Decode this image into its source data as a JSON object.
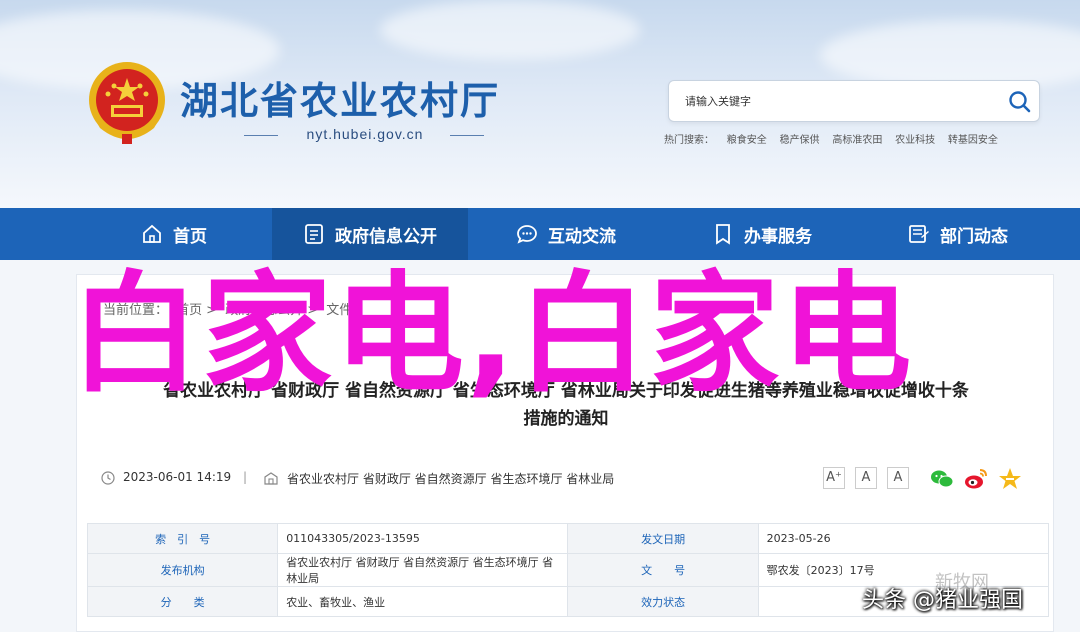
{
  "header": {
    "site_title": "湖北省农业农村厅",
    "domain": "nyt.hubei.gov.cn",
    "search_placeholder": "请输入关键字",
    "hot_search_label": "热门搜索：",
    "hot_search_items": [
      "粮食安全",
      "稳产保供",
      "高标准农田",
      "农业科技",
      "转基因安全"
    ]
  },
  "nav": {
    "items": [
      {
        "label": "首页",
        "icon": "home-icon"
      },
      {
        "label": "政府信息公开",
        "icon": "document-list-icon"
      },
      {
        "label": "互动交流",
        "icon": "chat-bubble-icon"
      },
      {
        "label": "办事服务",
        "icon": "bookmark-icon"
      },
      {
        "label": "部门动态",
        "icon": "news-icon"
      }
    ],
    "active_index": 1
  },
  "article": {
    "breadcrumb_label": "当前位置：",
    "breadcrumb": [
      "首页",
      "政府信息公开",
      "文件"
    ],
    "title_line1": "省农业农村厅 省财政厅 省自然资源厅 省生态环境厅 省林业局关于印发促进生猪等养殖业稳增收促增收十条",
    "title_line2": "措施的通知",
    "date": "2023-06-01 14:19",
    "separator": "|",
    "source": "省农业农村厅 省财政厅 省自然资源厅 省生态环境厅 省林业局",
    "font_buttons": [
      "A⁺",
      "A",
      "A"
    ]
  },
  "info_table": {
    "rows": [
      {
        "label1": "索　引　号",
        "value1": "011043305/2023-13595",
        "label2": "发文日期",
        "value2": "2023-05-26"
      },
      {
        "label1": "发布机构",
        "value1": "省农业农村厅 省财政厅 省自然资源厅 省生态环境厅 省林业局",
        "label2": "文　　号",
        "value2": "鄂农发〔2023〕17号"
      },
      {
        "label1": "分　　类",
        "value1": "农业、畜牧业、渔业",
        "label2": "效力状态",
        "value2": ""
      }
    ]
  },
  "overlay": {
    "text": "白家电,白家电",
    "watermark": "头条 @猪业强国",
    "faint_watermark": "新牧网"
  },
  "colors": {
    "nav_bg": "#1d64b8",
    "title_blue": "#1d5fab",
    "overlay_magenta": "#f013d8"
  }
}
